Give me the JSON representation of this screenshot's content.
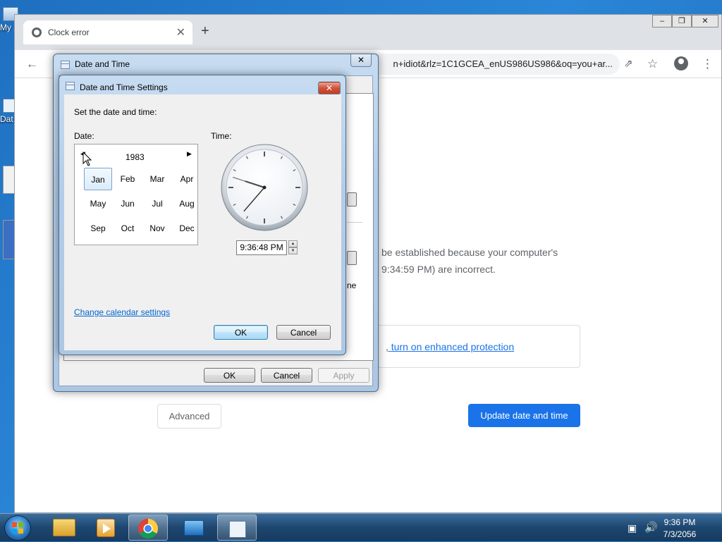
{
  "desktop": {
    "icons": [
      {
        "label": "My"
      },
      {
        "label": "Dat"
      }
    ]
  },
  "chrome": {
    "tab_title": "Clock error",
    "tab_close": "✕",
    "new_tab": "+",
    "url": "n+idiot&rlz=1C1GCEA_enUS986US986&oq=you+ar...",
    "error_line1": "be established because your computer's",
    "error_line2": "9:34:59 PM) are incorrect.",
    "protection_link_prefix": ", ",
    "protection_link": "turn on enhanced protection",
    "advanced_button": "Advanced",
    "update_button": "Update date and time"
  },
  "date_time_window": {
    "title": "Date and Time",
    "ok": "OK",
    "cancel": "Cancel",
    "apply": "Apply",
    "partial_text": "ne"
  },
  "settings_dialog": {
    "title": "Date and Time Settings",
    "instruction": "Set the date and time:",
    "date_label": "Date:",
    "time_label": "Time:",
    "year": "1983",
    "months": [
      "Jan",
      "Feb",
      "Mar",
      "Apr",
      "May",
      "Jun",
      "Jul",
      "Aug",
      "Sep",
      "Oct",
      "Nov",
      "Dec"
    ],
    "selected_month": "Jan",
    "time_value": "9:36:48 PM",
    "change_calendar_link": "Change calendar settings",
    "ok": "OK",
    "cancel": "Cancel"
  },
  "taskbar": {
    "clock_time": "9:36 PM",
    "clock_date": "7/3/2056"
  },
  "colors": {
    "chrome_blue": "#1a73e8",
    "link_blue": "#0066cc",
    "win7_frame": "#b3cde8",
    "taskbar": "#1d4670"
  }
}
